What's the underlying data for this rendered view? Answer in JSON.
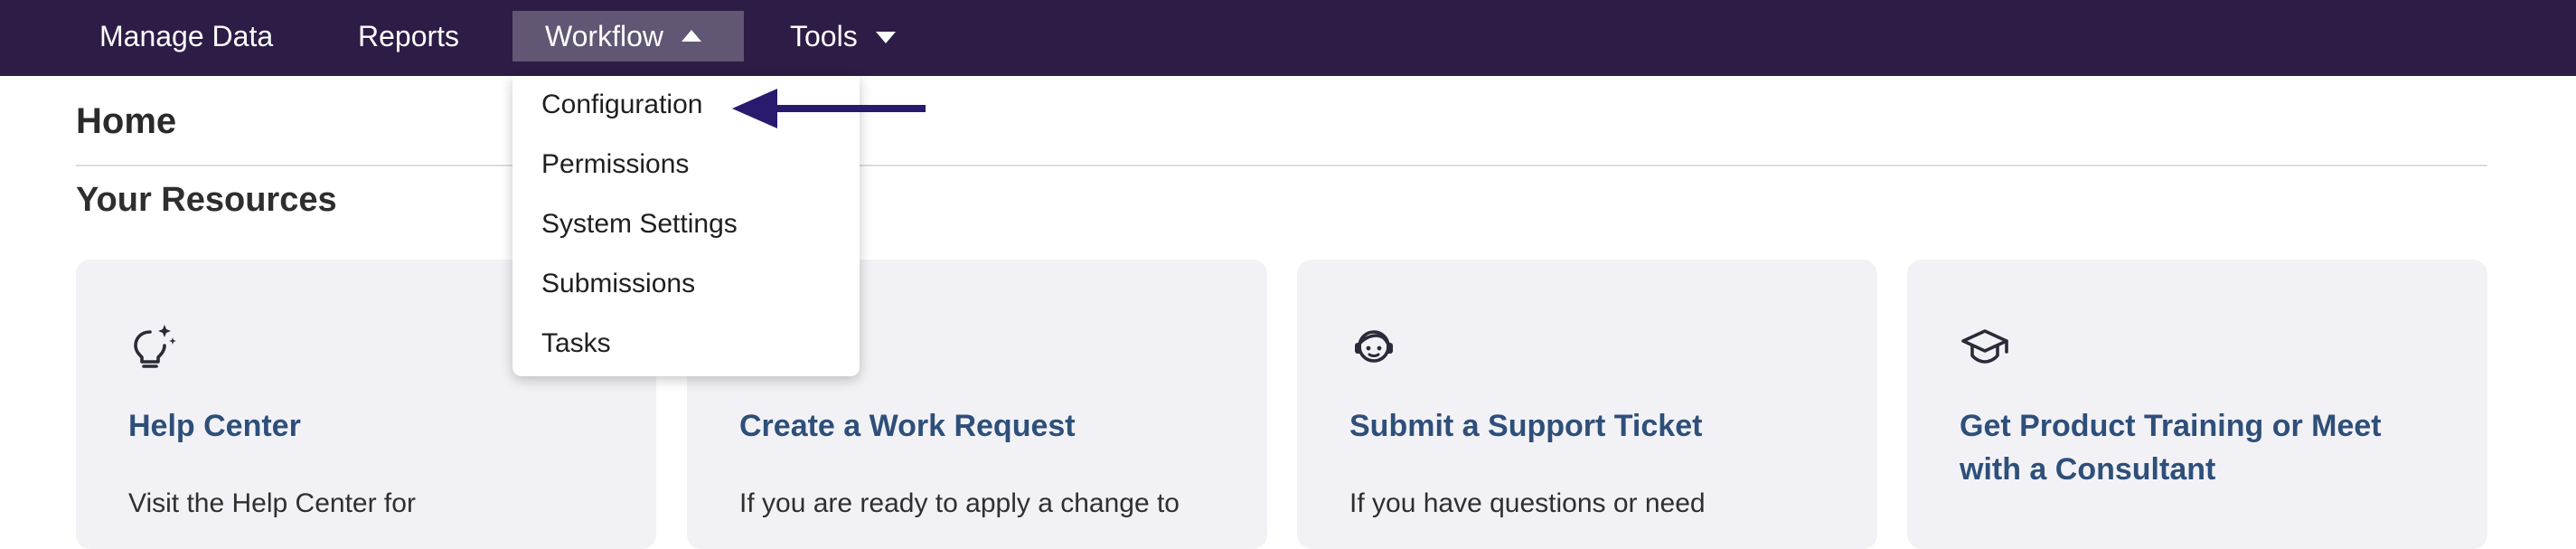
{
  "nav": {
    "items": [
      {
        "label": "Manage Data"
      },
      {
        "label": "Reports"
      },
      {
        "label": "Workflow"
      },
      {
        "label": "Tools"
      }
    ]
  },
  "page": {
    "title": "Home",
    "section_title": "Your Resources"
  },
  "dropdown": {
    "items": [
      {
        "label": "Configuration"
      },
      {
        "label": "Permissions"
      },
      {
        "label": "System Settings"
      },
      {
        "label": "Submissions"
      },
      {
        "label": "Tasks"
      }
    ]
  },
  "cards": [
    {
      "icon": "lightbulb-sparkle-icon",
      "title": "Help Center",
      "description": "Visit the Help Center for"
    },
    {
      "icon": "",
      "title": "Create a Work Request",
      "description": "If you are ready to apply a change to"
    },
    {
      "icon": "support-agent-headset-icon",
      "title": "Submit a Support Ticket",
      "description": "If you have questions or need"
    },
    {
      "icon": "graduation-cap-icon",
      "title": "Get Product Training or Meet with a Consultant",
      "description": ""
    }
  ],
  "colors": {
    "nav_background": "#2d1c46",
    "nav_active": "#615673",
    "card_background": "#f2f2f6",
    "card_title": "#2e4f7a",
    "annotation_arrow": "#2a1a6e"
  }
}
